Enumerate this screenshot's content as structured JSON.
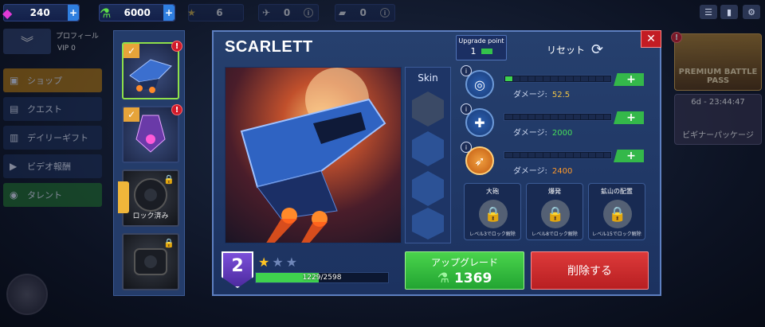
{
  "topbar": {
    "gems": "240",
    "energy": "6000",
    "stars": "6",
    "tickets": "0",
    "books": "0"
  },
  "left_menu": {
    "profile_label": "プロフィール",
    "vip": "VIP 0",
    "items": [
      {
        "label": "ショップ",
        "icon": "shop-icon"
      },
      {
        "label": "クエスト",
        "icon": "quest-icon"
      },
      {
        "label": "デイリーギフト",
        "icon": "gift-icon"
      },
      {
        "label": "ビデオ報酬",
        "icon": "video-icon"
      },
      {
        "label": "タレント",
        "icon": "talent-icon"
      }
    ]
  },
  "hero_list": {
    "locked_label": "ロック済み"
  },
  "panel": {
    "hero_name": "SCARLETT",
    "skin_label": "Skin",
    "upgrade_point_label": "Upgrade point",
    "upgrade_point_value": "1",
    "reset_label": "リセット",
    "skills": [
      {
        "damage_label": "ダメージ:",
        "damage_value": "52.5",
        "level_fraction": 0.07
      },
      {
        "damage_label": "ダメージ:",
        "damage_value": "2000",
        "level_fraction": 0
      },
      {
        "damage_label": "ダメージ:",
        "damage_value": "2400",
        "level_fraction": 0
      }
    ],
    "locked_skills": [
      {
        "title": "大砲",
        "unlock": "レベル3でロック解除"
      },
      {
        "title": "爆発",
        "unlock": "レベル8でロック解除"
      },
      {
        "title": "鉱山の配置",
        "unlock": "レベル15でロック解除"
      }
    ],
    "level": "2",
    "stars_filled": 1,
    "stars_total": 3,
    "xp_text": "1229/2598",
    "xp_current": 1229,
    "xp_max": 2598,
    "upgrade_button": "アップグレード",
    "upgrade_cost": "1369",
    "delete_button": "削除する"
  },
  "right": {
    "battle_pass": "PREMIUM BATTLE PASS",
    "timer": "6d - 23:44:47",
    "beginner_pack": "ビギナーパッケージ"
  },
  "colors": {
    "accent_green": "#3fd24e",
    "delete_red": "#c31c23",
    "damage_yellow": "#f0c447",
    "damage_orange": "#ff9a2a"
  }
}
